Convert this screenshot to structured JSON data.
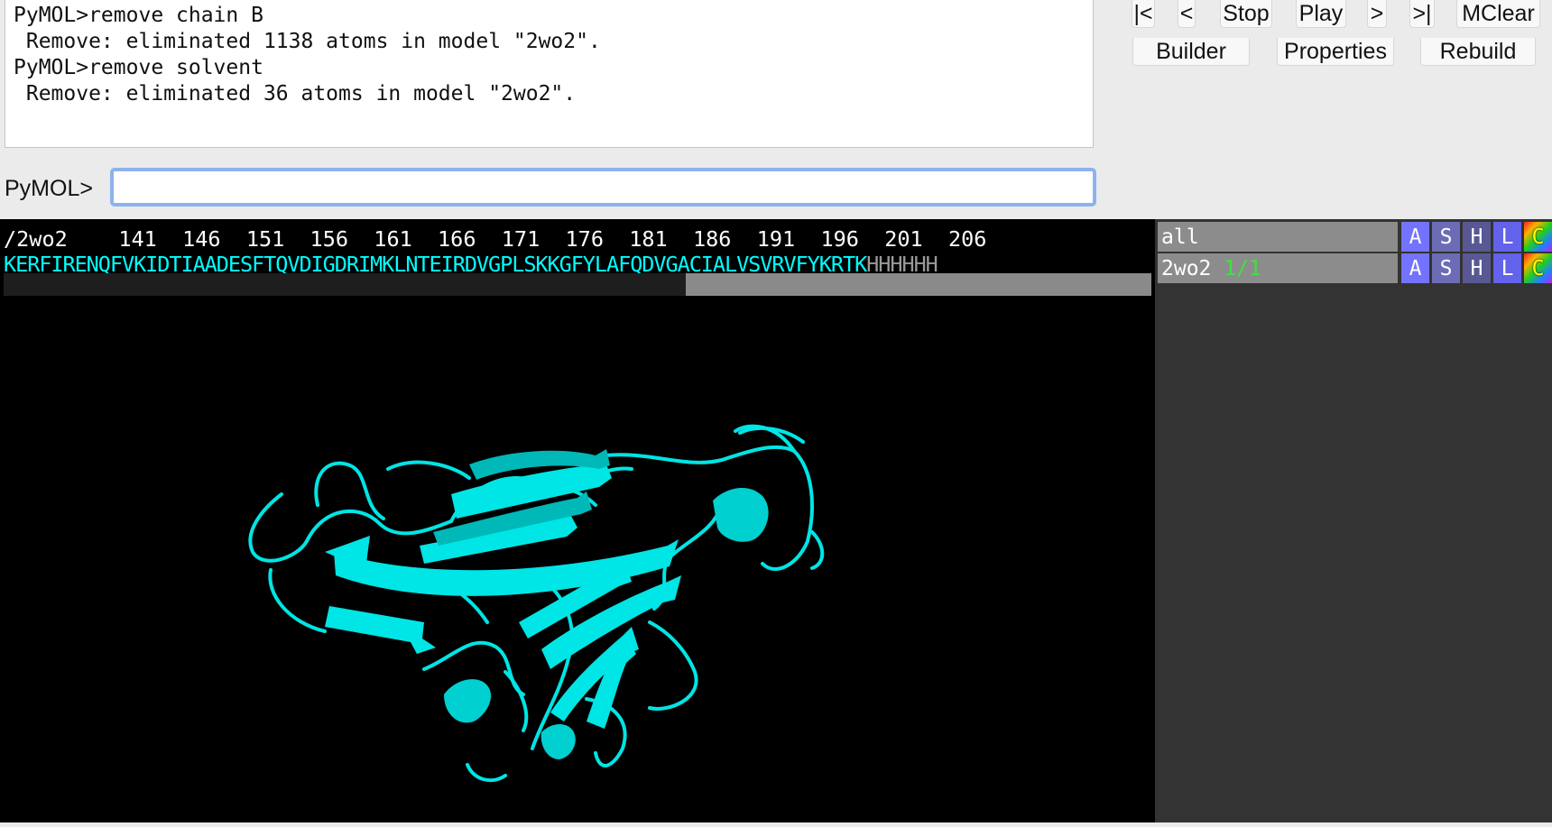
{
  "console": {
    "lines": [
      "PyMOL>remove chain B",
      " Remove: eliminated 1138 atoms in model \"2wo2\".",
      "PyMOL>remove solvent",
      " Remove: eliminated 36 atoms in model \"2wo2\"."
    ]
  },
  "command": {
    "prompt": "PyMOL>",
    "value": ""
  },
  "movie_controls": {
    "rewind": "|<",
    "back": "<",
    "stop": "Stop",
    "play": "Play",
    "forward": ">",
    "end": ">|",
    "mclear": "MClear"
  },
  "tools": {
    "builder": "Builder",
    "properties": "Properties",
    "rebuild": "Rebuild"
  },
  "sequence": {
    "header": "/2wo2    141  146  151  156  161  166  171  176  181  186  191  196  201  206",
    "residues": "KERFIRENQFVKIDTIAADESFTQVDIGDRIMKLNTEIRDVGPLSKKGFYLAFQDVGACIALVSVRVFYKRTK",
    "tail": "HHHHHH",
    "residue_color": "#00ffff",
    "tail_color": "#9a9a9a"
  },
  "viewport": {
    "background": "#000000",
    "cartoon_color": "#00e5e5"
  },
  "objects": [
    {
      "name": "all",
      "states": "",
      "buttons": [
        "A",
        "S",
        "H",
        "L",
        "C"
      ]
    },
    {
      "name": "2wo2",
      "states": "1/1",
      "buttons": [
        "A",
        "S",
        "H",
        "L",
        "C"
      ]
    }
  ]
}
